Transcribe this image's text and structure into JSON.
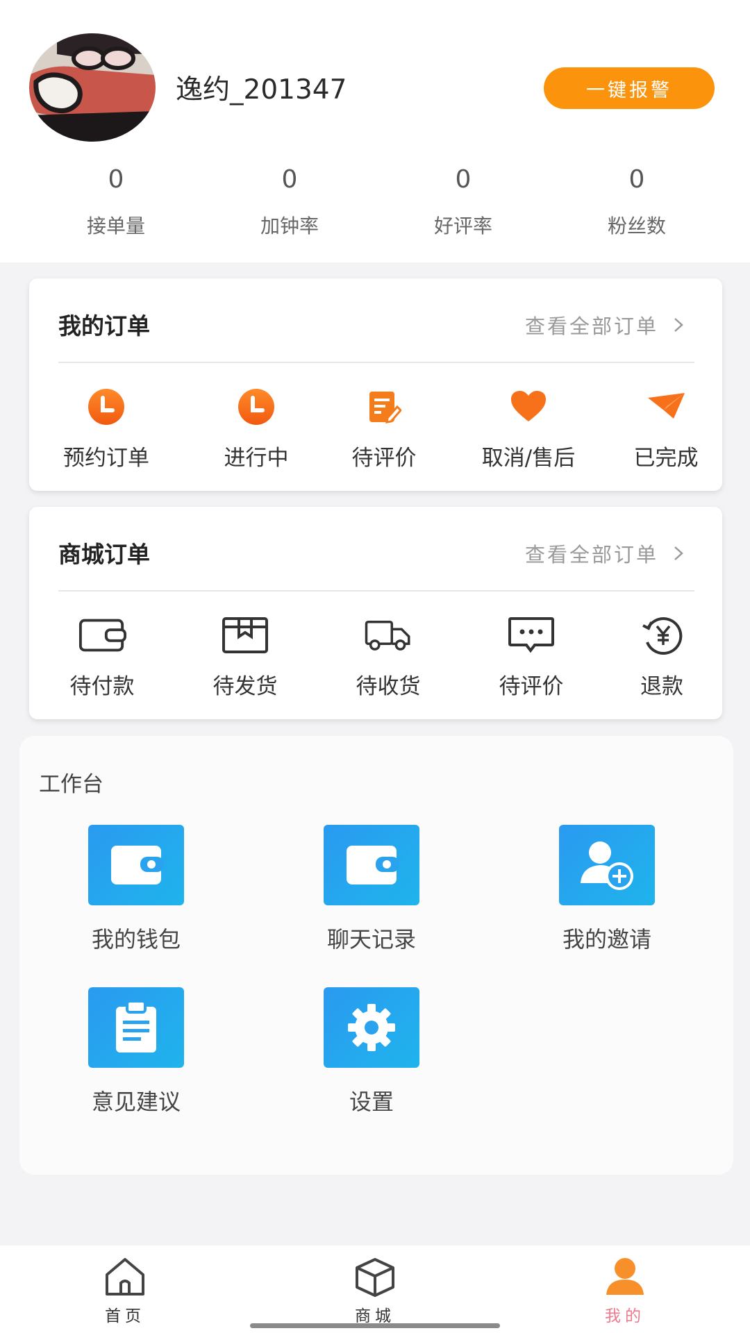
{
  "profile": {
    "username": "逸约_201347",
    "alarm_label": "一键报警"
  },
  "stats": [
    {
      "value": "0",
      "label": "接单量"
    },
    {
      "value": "0",
      "label": "加钟率"
    },
    {
      "value": "0",
      "label": "好评率"
    },
    {
      "value": "0",
      "label": "粉丝数"
    }
  ],
  "my_orders": {
    "title": "我的订单",
    "view_all": "查看全部订单",
    "items": [
      {
        "label": "预约订单",
        "icon": "clock-icon"
      },
      {
        "label": "进行中",
        "icon": "clock-icon"
      },
      {
        "label": "待评价",
        "icon": "edit-note-icon"
      },
      {
        "label": "取消/售后",
        "icon": "heart-icon"
      },
      {
        "label": "已完成",
        "icon": "paper-plane-icon"
      }
    ]
  },
  "shop_orders": {
    "title": "商城订单",
    "view_all": "查看全部订单",
    "items": [
      {
        "label": "待付款",
        "icon": "wallet-icon"
      },
      {
        "label": "待发货",
        "icon": "package-icon"
      },
      {
        "label": "待收货",
        "icon": "truck-icon"
      },
      {
        "label": "待评价",
        "icon": "chat-bubble-icon"
      },
      {
        "label": "退款",
        "icon": "refund-yen-icon"
      }
    ]
  },
  "workbench": {
    "title": "工作台",
    "tools": [
      {
        "label": "我的钱包",
        "icon": "wallet-icon"
      },
      {
        "label": "聊天记录",
        "icon": "wallet-icon"
      },
      {
        "label": "我的邀请",
        "icon": "add-user-icon"
      },
      {
        "label": "意见建议",
        "icon": "clipboard-icon"
      },
      {
        "label": "设置",
        "icon": "gear-icon"
      }
    ]
  },
  "tabbar": {
    "items": [
      {
        "label": "首页",
        "icon": "home-icon",
        "active": false
      },
      {
        "label": "商城",
        "icon": "box-icon",
        "active": false
      },
      {
        "label": "我的",
        "icon": "user-icon",
        "active": true
      }
    ]
  },
  "colors": {
    "accent_orange": "#fb930c",
    "tool_blue": "#2a9af0",
    "active_tab": "#ee7a8c"
  }
}
